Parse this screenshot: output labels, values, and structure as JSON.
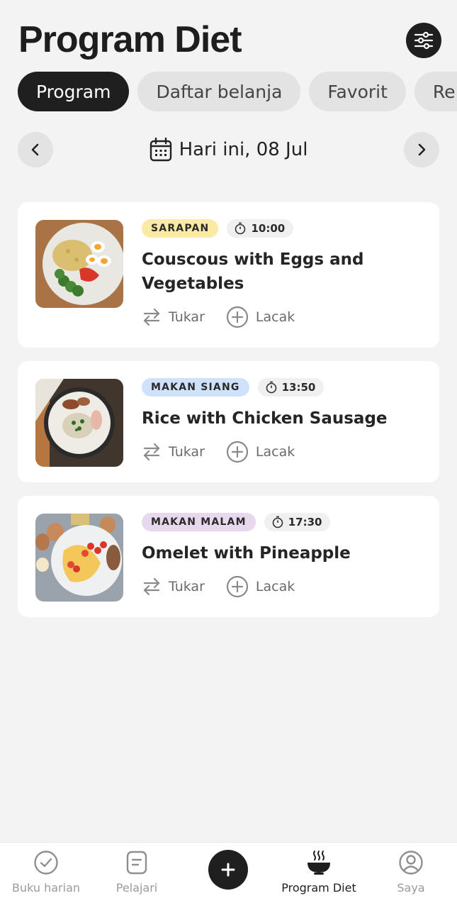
{
  "header": {
    "title": "Program Diet"
  },
  "tabs": [
    {
      "label": "Program",
      "active": true
    },
    {
      "label": "Daftar belanja",
      "active": false
    },
    {
      "label": "Favorit",
      "active": false
    },
    {
      "label": "Re",
      "active": false
    }
  ],
  "date_nav": {
    "label": "Hari ini, 08 Jul"
  },
  "meals": [
    {
      "type": "SARAPAN",
      "time": "10:00",
      "title": "Couscous with Eggs and Vegetables",
      "tag_color": "#fbeaa6",
      "swap_label": "Tukar",
      "track_label": "Lacak"
    },
    {
      "type": "MAKAN SIANG",
      "time": "13:50",
      "title": "Rice with Chicken Sausage",
      "tag_color": "#cfe2fa",
      "swap_label": "Tukar",
      "track_label": "Lacak"
    },
    {
      "type": "MAKAN MALAM",
      "time": "17:30",
      "title": "Omelet with Pineapple",
      "tag_color": "#e8d8ee",
      "swap_label": "Tukar",
      "track_label": "Lacak"
    }
  ],
  "bottom_nav": [
    {
      "label": "Buku harian",
      "icon": "check-circle-icon",
      "active": false
    },
    {
      "label": "Pelajari",
      "icon": "document-icon",
      "active": false
    },
    {
      "label": "",
      "icon": "plus-icon",
      "active": false
    },
    {
      "label": "Program Diet",
      "icon": "bowl-icon",
      "active": true
    },
    {
      "label": "Saya",
      "icon": "user-circle-icon",
      "active": false
    }
  ]
}
